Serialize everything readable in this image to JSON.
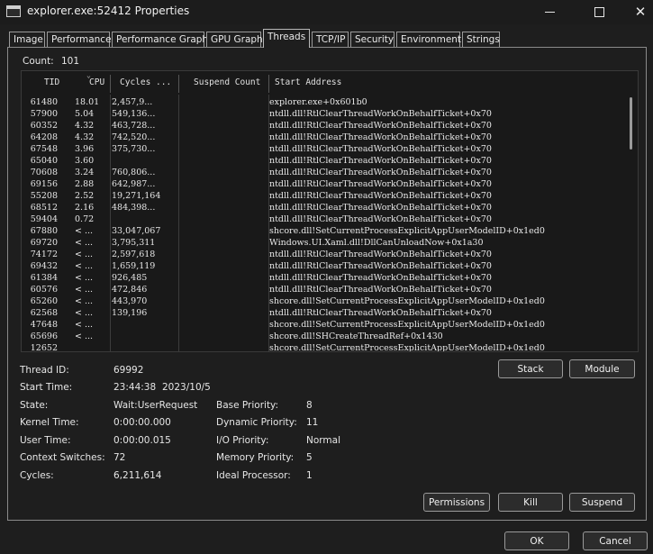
{
  "window": {
    "title": "explorer.exe:52412 Properties",
    "icon": "window-app-icon",
    "controls": {
      "minimize": "minimize-icon",
      "maximize": "maximize-icon",
      "close": "close-icon"
    }
  },
  "tabs": [
    {
      "label": "Image"
    },
    {
      "label": "Performance"
    },
    {
      "label": "Performance Graph"
    },
    {
      "label": "GPU Graph"
    },
    {
      "label": "Threads",
      "active": true
    },
    {
      "label": "TCP/IP"
    },
    {
      "label": "Security"
    },
    {
      "label": "Environment"
    },
    {
      "label": "Strings"
    }
  ],
  "threads": {
    "count_label": "Count:",
    "count": "101",
    "columns": {
      "tid": "TID",
      "cpu": "CPU",
      "cycles": "Cycles ...",
      "suspend": "Suspend Count",
      "start": "Start Address"
    },
    "rows": [
      {
        "tid": "61480",
        "cpu": "18.01",
        "cycles": "2,457,9...",
        "start": "explorer.exe+0x601b0"
      },
      {
        "tid": "57900",
        "cpu": "5.04",
        "cycles": "549,136...",
        "start": "ntdll.dll!RtlClearThreadWorkOnBehalfTicket+0x70"
      },
      {
        "tid": "60352",
        "cpu": "4.32",
        "cycles": "463,728...",
        "start": "ntdll.dll!RtlClearThreadWorkOnBehalfTicket+0x70"
      },
      {
        "tid": "64208",
        "cpu": "4.32",
        "cycles": "742,520...",
        "start": "ntdll.dll!RtlClearThreadWorkOnBehalfTicket+0x70"
      },
      {
        "tid": "67548",
        "cpu": "3.96",
        "cycles": "375,730...",
        "start": "ntdll.dll!RtlClearThreadWorkOnBehalfTicket+0x70"
      },
      {
        "tid": "65040",
        "cpu": "3.60",
        "cycles": "",
        "start": "ntdll.dll!RtlClearThreadWorkOnBehalfTicket+0x70"
      },
      {
        "tid": "70608",
        "cpu": "3.24",
        "cycles": "760,806...",
        "start": "ntdll.dll!RtlClearThreadWorkOnBehalfTicket+0x70"
      },
      {
        "tid": "69156",
        "cpu": "2.88",
        "cycles": "642,987...",
        "start": "ntdll.dll!RtlClearThreadWorkOnBehalfTicket+0x70"
      },
      {
        "tid": "55208",
        "cpu": "2.52",
        "cycles": "19,271,164",
        "start": "ntdll.dll!RtlClearThreadWorkOnBehalfTicket+0x70"
      },
      {
        "tid": "68512",
        "cpu": "2.16",
        "cycles": "484,398...",
        "start": "ntdll.dll!RtlClearThreadWorkOnBehalfTicket+0x70"
      },
      {
        "tid": "59404",
        "cpu": "0.72",
        "cycles": "",
        "start": "ntdll.dll!RtlClearThreadWorkOnBehalfTicket+0x70"
      },
      {
        "tid": "67880",
        "cpu": "< ...",
        "cycles": "33,047,067",
        "start": "shcore.dll!SetCurrentProcessExplicitAppUserModelID+0x1ed0"
      },
      {
        "tid": "69720",
        "cpu": "< ...",
        "cycles": "3,795,311",
        "start": "Windows.UI.Xaml.dll!DllCanUnloadNow+0x1a30"
      },
      {
        "tid": "74172",
        "cpu": "< ...",
        "cycles": "2,597,618",
        "start": "ntdll.dll!RtlClearThreadWorkOnBehalfTicket+0x70"
      },
      {
        "tid": "69432",
        "cpu": "< ...",
        "cycles": "1,659,119",
        "start": "ntdll.dll!RtlClearThreadWorkOnBehalfTicket+0x70"
      },
      {
        "tid": "61384",
        "cpu": "< ...",
        "cycles": "926,485",
        "start": "ntdll.dll!RtlClearThreadWorkOnBehalfTicket+0x70"
      },
      {
        "tid": "60576",
        "cpu": "< ...",
        "cycles": "472,846",
        "start": "ntdll.dll!RtlClearThreadWorkOnBehalfTicket+0x70"
      },
      {
        "tid": "65260",
        "cpu": "< ...",
        "cycles": "443,970",
        "start": "shcore.dll!SetCurrentProcessExplicitAppUserModelID+0x1ed0"
      },
      {
        "tid": "62568",
        "cpu": "< ...",
        "cycles": "139,196",
        "start": "ntdll.dll!RtlClearThreadWorkOnBehalfTicket+0x70"
      },
      {
        "tid": "47648",
        "cpu": "< ...",
        "cycles": "",
        "start": "shcore.dll!SetCurrentProcessExplicitAppUserModelID+0x1ed0"
      },
      {
        "tid": "65696",
        "cpu": "< ...",
        "cycles": "",
        "start": "shcore.dll!SHCreateThreadRef+0x1430"
      },
      {
        "tid": "12652",
        "cpu": "",
        "cycles": "",
        "start": "shcore.dll!SetCurrentProcessExplicitAppUserModelID+0x1ed0"
      }
    ]
  },
  "details": {
    "thread_id_label": "Thread ID:",
    "thread_id": "69992",
    "start_time_label": "Start Time:",
    "start_time": "23:44:38",
    "start_date": "2023/10/5",
    "state_label": "State:",
    "state": "Wait:UserRequest",
    "kernel_time_label": "Kernel Time:",
    "kernel_time": "0:00:00.000",
    "user_time_label": "User Time:",
    "user_time": "0:00:00.015",
    "context_switches_label": "Context Switches:",
    "context_switches": "72",
    "cycles_label": "Cycles:",
    "cycles": "6,211,614",
    "base_priority_label": "Base Priority:",
    "base_priority": "8",
    "dynamic_priority_label": "Dynamic Priority:",
    "dynamic_priority": "11",
    "io_priority_label": "I/O Priority:",
    "io_priority": "Normal",
    "memory_priority_label": "Memory Priority:",
    "memory_priority": "5",
    "ideal_processor_label": "Ideal Processor:",
    "ideal_processor": "1"
  },
  "buttons": {
    "stack": "Stack",
    "module": "Module",
    "permissions": "Permissions",
    "kill": "Kill",
    "suspend": "Suspend",
    "ok": "OK",
    "cancel": "Cancel"
  }
}
